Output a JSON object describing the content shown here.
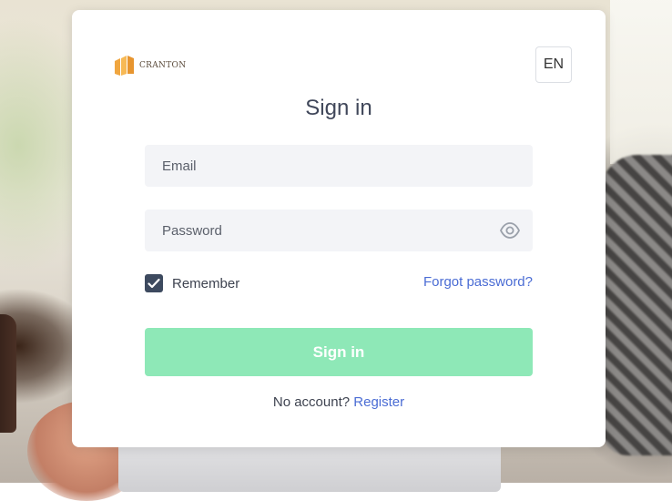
{
  "brand": {
    "name": "CRANTON"
  },
  "language_button": {
    "label": "EN"
  },
  "title": "Sign in",
  "email": {
    "placeholder": "Email",
    "value": ""
  },
  "password": {
    "placeholder": "Password",
    "value": ""
  },
  "remember": {
    "label": "Remember",
    "checked": true
  },
  "forgot_link": "Forgot password?",
  "submit_label": "Sign in",
  "footer": {
    "prompt": "No account?",
    "register_link": "Register"
  },
  "colors": {
    "accent_button": "#8ee8b7",
    "link": "#4a6cd4",
    "checkbox": "#3d4a5f",
    "logo": "#f0a640"
  },
  "icons": {
    "password_toggle": "eye-icon",
    "checkbox_mark": "check-icon"
  }
}
